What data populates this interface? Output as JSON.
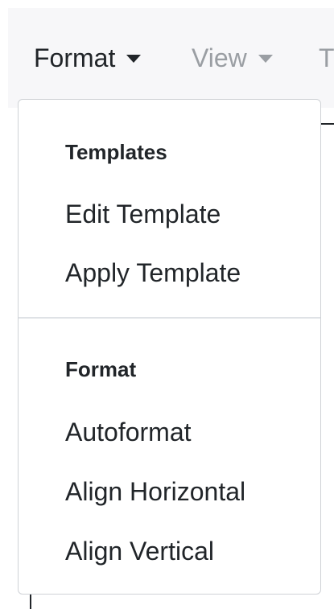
{
  "menubar": {
    "items": [
      {
        "label": "Format",
        "active": true
      },
      {
        "label": "View",
        "active": false
      },
      {
        "label": "T",
        "active": false
      }
    ]
  },
  "dropdown": {
    "sections": [
      {
        "header": "Templates",
        "items": [
          {
            "label": "Edit Template"
          },
          {
            "label": "Apply Template"
          }
        ]
      },
      {
        "header": "Format",
        "items": [
          {
            "label": "Autoformat"
          },
          {
            "label": "Align Horizontal"
          },
          {
            "label": "Align Vertical"
          }
        ]
      }
    ]
  },
  "colors": {
    "text": "#212529",
    "muted_text": "#9a9ea3",
    "menubar_background": "#f7f7f9",
    "dropdown_border": "#cfd2d6",
    "divider": "#dfe2e6"
  },
  "icons": {
    "menu_caret": "caret-down-icon"
  }
}
